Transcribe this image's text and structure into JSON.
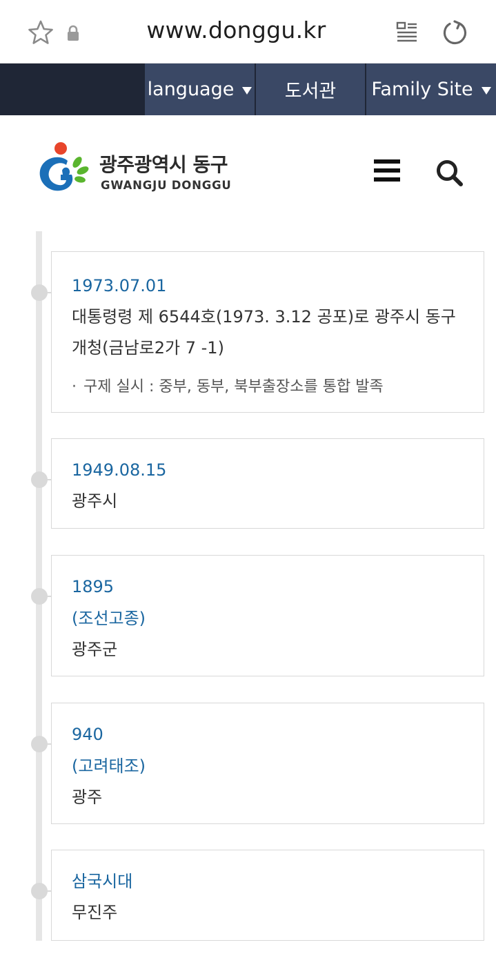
{
  "browser": {
    "url": "www.donggu.kr",
    "icons": [
      "star-icon",
      "lock-icon",
      "reader-mode-icon",
      "reload-icon"
    ]
  },
  "util_nav": {
    "language_label": "language",
    "library_label": "도서관",
    "family_site_label": "Family Site"
  },
  "header": {
    "logo_title": "광주광역시 동구",
    "logo_subtitle": "GWANGJU DONGGU",
    "icons": [
      "hamburger-menu-icon",
      "search-icon"
    ]
  },
  "colors": {
    "util_nav_bg": "#1f2636",
    "util_button_bg": "#3a4865",
    "date_color": "#1a66a0",
    "logo_blue": "#1b6fb8",
    "logo_green": "#5ab52e",
    "logo_red": "#e8452b"
  },
  "timeline": [
    {
      "date": "1973.07.01",
      "lines": [
        "대통령령 제 6544호(1973. 3.12 공포)로 광주시 동구",
        "개청(금남로2가 7 -1)"
      ],
      "note": "구제 실시 : 중부, 동부, 북부출장소를 통합 발족"
    },
    {
      "date": "1949.08.15",
      "lines": [
        "광주시"
      ]
    },
    {
      "date": "1895",
      "date_sub": "(조선고종)",
      "lines": [
        "광주군"
      ]
    },
    {
      "date": "940",
      "date_sub": "(고려태조)",
      "lines": [
        "광주"
      ]
    },
    {
      "date": "삼국시대",
      "lines": [
        "무진주"
      ]
    }
  ]
}
